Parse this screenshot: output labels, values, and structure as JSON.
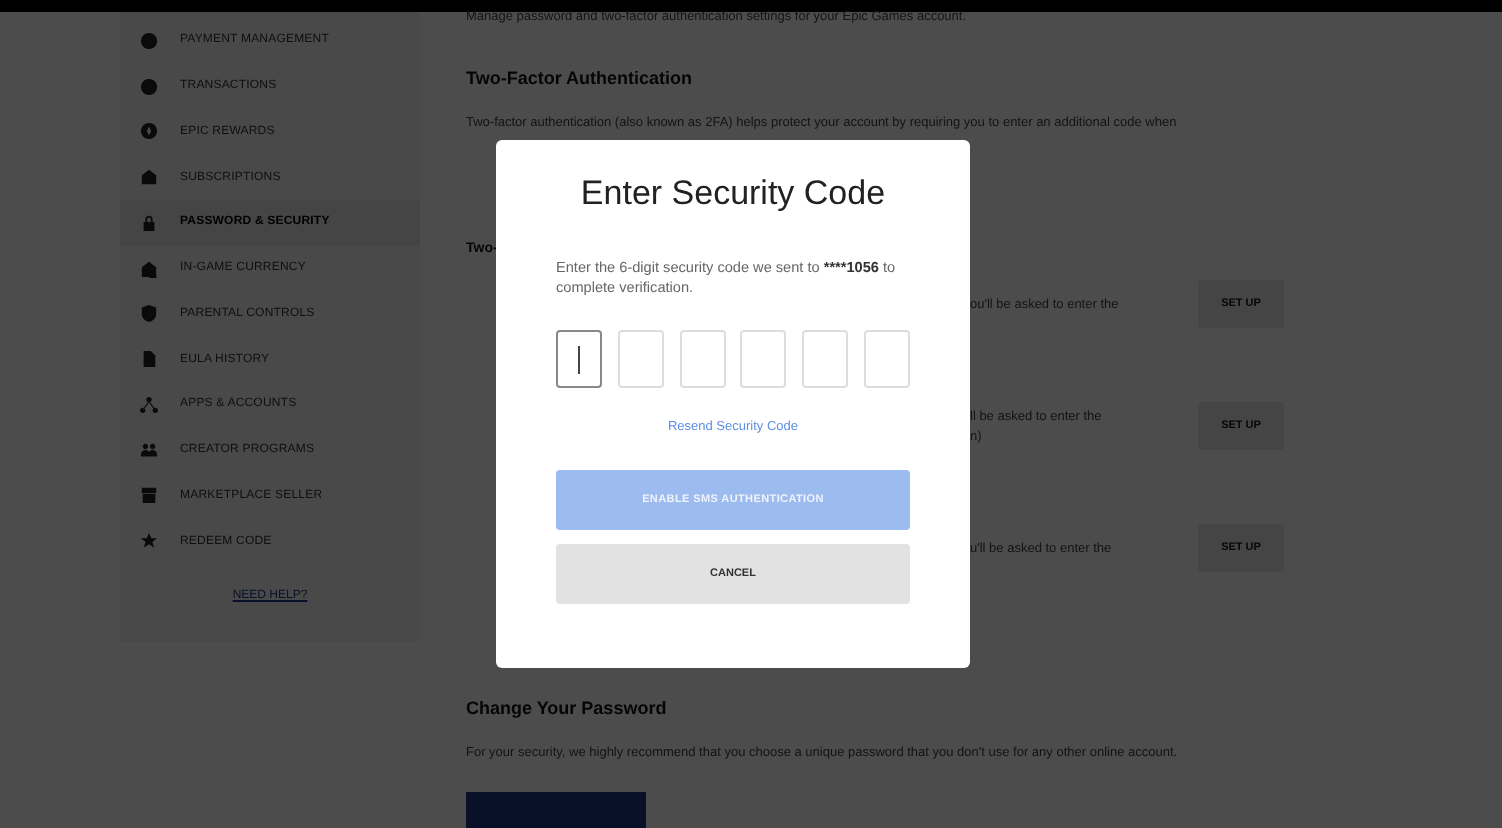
{
  "sidebar": {
    "items": [
      {
        "label": "PAYMENT MANAGEMENT",
        "selected": false
      },
      {
        "label": "TRANSACTIONS",
        "selected": false
      },
      {
        "label": "EPIC REWARDS",
        "selected": false
      },
      {
        "label": "SUBSCRIPTIONS",
        "selected": false
      },
      {
        "label": "PASSWORD & SECURITY",
        "selected": true
      },
      {
        "label": "IN-GAME CURRENCY",
        "selected": false
      },
      {
        "label": "PARENTAL CONTROLS",
        "selected": false
      },
      {
        "label": "EULA HISTORY",
        "selected": false
      },
      {
        "label": "APPS & ACCOUNTS",
        "selected": false
      },
      {
        "label": "CREATOR PROGRAMS",
        "selected": false
      },
      {
        "label": "MARKETPLACE SELLER",
        "selected": false
      },
      {
        "label": "REDEEM CODE",
        "selected": false
      }
    ],
    "help_link": "NEED HELP?"
  },
  "main": {
    "intro": "Manage password and two-factor authentication settings for your Epic Games account.",
    "two_factor": {
      "heading": "Two-Factor Authentication",
      "description": "Two-factor authentication (also known as 2FA) helps protect your account by requiring you to enter an additional code when",
      "subheading": "Two-",
      "methods": [
        {
          "text_lines": [
            "ou'll be asked to enter the"
          ],
          "button": "SET UP"
        },
        {
          "text_lines": [
            "ll be asked to enter the",
            "n)"
          ],
          "button": "SET UP"
        },
        {
          "text_lines": [
            "u'll be asked to enter the"
          ],
          "button": "SET UP"
        }
      ]
    },
    "change_password": {
      "heading": "Change Your Password",
      "description": "For your security, we highly recommend that you choose a unique password that you don't use for any other online account."
    }
  },
  "modal": {
    "title": "Enter Security Code",
    "message": {
      "before": "Enter the 6-digit security code we sent to ",
      "phone": "****1056",
      "after": " to complete verification."
    },
    "code_boxes": [
      {
        "focused": true
      },
      {
        "focused": false
      },
      {
        "focused": false
      },
      {
        "focused": false
      },
      {
        "focused": false
      },
      {
        "focused": false
      }
    ],
    "resend_link": "Resend Security Code",
    "primary_button": {
      "label": "ENABLE SMS AUTHENTICATION",
      "disabled": true
    },
    "cancel_button": "CANCEL"
  }
}
